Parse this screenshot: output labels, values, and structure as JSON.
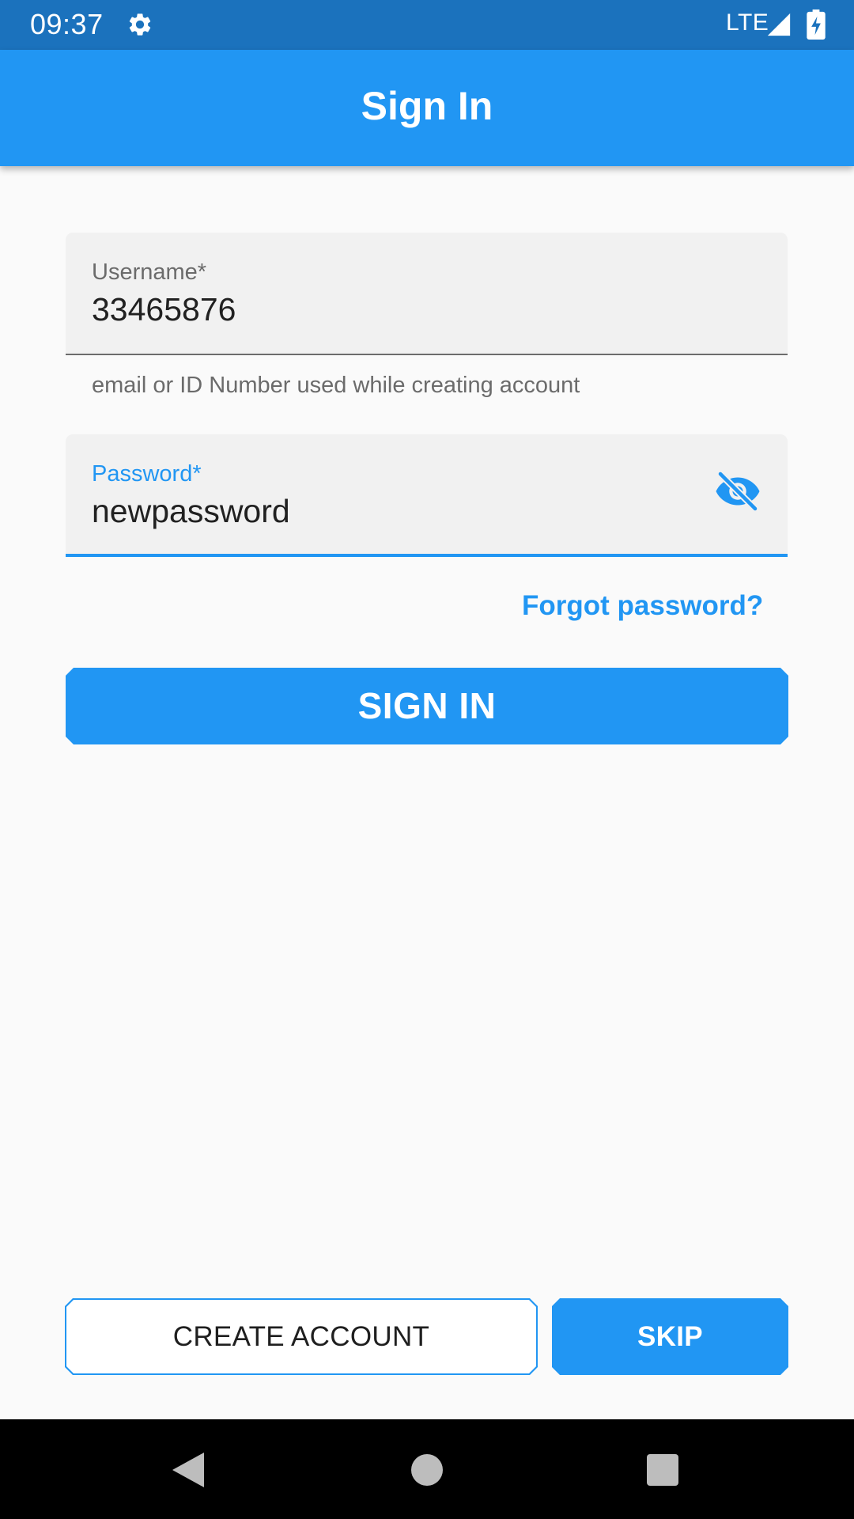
{
  "status_bar": {
    "time": "09:37",
    "network": "LTE",
    "icons": [
      "settings-gear-icon",
      "signal-icon",
      "battery-charging-icon"
    ]
  },
  "app_bar": {
    "title": "Sign In",
    "color": "#2196f3"
  },
  "form": {
    "username": {
      "label": "Username*",
      "value": "33465876",
      "helper": "email or ID Number used while creating account"
    },
    "password": {
      "label": "Password*",
      "value": "newpassword",
      "visibility_icon": "eye-off-icon"
    },
    "forgot_password": "Forgot password?",
    "sign_in_button": "SIGN IN"
  },
  "footer": {
    "create_account_button": "CREATE ACCOUNT",
    "skip_button": "SKIP"
  },
  "nav_bar": {
    "icons": [
      "back-icon",
      "home-icon",
      "recents-icon"
    ]
  },
  "colors": {
    "primary": "#2196f3",
    "status_bar": "#1b72bd",
    "background": "#fafafa"
  }
}
